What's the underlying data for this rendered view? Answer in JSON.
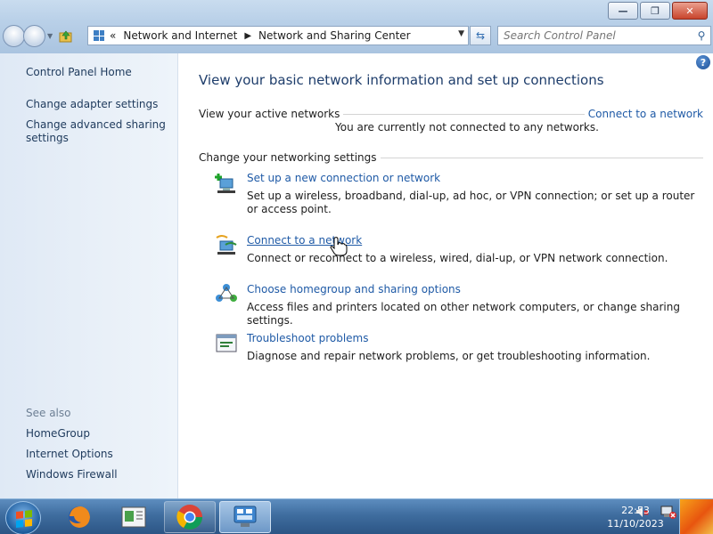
{
  "window": {
    "minimize_glyph": "—",
    "maximize_glyph": "❐",
    "close_glyph": "✕"
  },
  "address": {
    "overflow": "«",
    "crumbs": [
      "Network and Internet",
      "Network and Sharing Center"
    ],
    "separator": "▶"
  },
  "search": {
    "placeholder": "Search Control Panel"
  },
  "sidebar": {
    "home": "Control Panel Home",
    "items": [
      {
        "label": "Change adapter settings"
      },
      {
        "label": "Change advanced sharing settings"
      }
    ],
    "see_also_title": "See also",
    "see_also": [
      "HomeGroup",
      "Internet Options",
      "Windows Firewall"
    ]
  },
  "main": {
    "headline": "View your basic network information and set up connections",
    "active_networks_label": "View your active networks",
    "connect_link": "Connect to a network",
    "not_connected": "You are currently not connected to any networks.",
    "settings_label": "Change your networking settings",
    "tasks": [
      {
        "icon": "new-connection-icon",
        "title": "Set up a new connection or network",
        "desc": "Set up a wireless, broadband, dial-up, ad hoc, or VPN connection; or set up a router or access point."
      },
      {
        "icon": "connect-network-icon",
        "title": "Connect to a network",
        "desc": "Connect or reconnect to a wireless, wired, dial-up, or VPN network connection."
      },
      {
        "icon": "homegroup-icon",
        "title": "Choose homegroup and sharing options",
        "desc": "Access files and printers located on other network computers, or change sharing settings."
      },
      {
        "icon": "troubleshoot-icon",
        "title": "Troubleshoot problems",
        "desc": "Diagnose and repair network problems, or get troubleshooting information."
      }
    ]
  },
  "taskbar": {
    "time": "22:53",
    "date": "11/10/2023"
  },
  "colors": {
    "link": "#1f5aa6",
    "headline": "#1e3d6b",
    "taskbar": "#3f6d9f",
    "sidebar": "#e4edf7"
  }
}
